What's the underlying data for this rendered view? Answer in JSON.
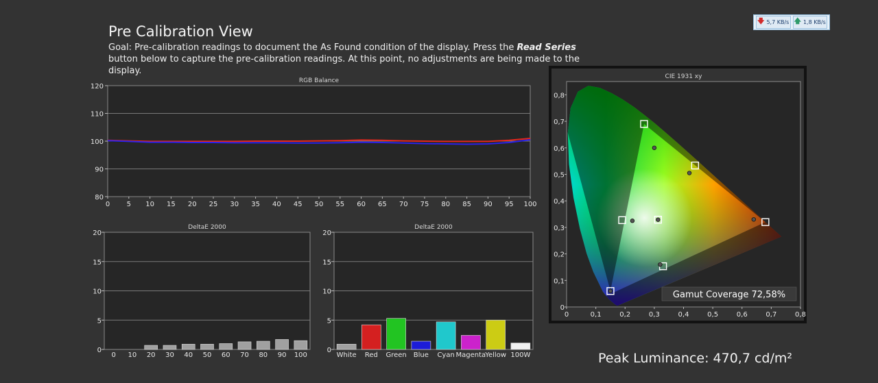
{
  "header": {
    "title": "Pre Calibration View",
    "goal_prefix": "Goal: Pre-calibration readings to document the As Found condition of the display. Press the ",
    "goal_emphasis": "Read Series",
    "goal_suffix": " button below to capture the pre-calibration readings. At this point, no adjustments are being made to the display."
  },
  "network": {
    "download": "5,7 KB/s",
    "upload": "1,8 KB/s"
  },
  "colors": {
    "red_line": "#e8261c",
    "blue_line": "#2b22e8",
    "gray_bar": "#a0a0a0",
    "red_bar": "#d42020",
    "green_bar": "#22c422",
    "blue_bar": "#1c1cd8",
    "cyan_bar": "#20c8cc",
    "magenta_bar": "#cc22cc",
    "yellow_bar": "#cccc14",
    "white_bar": "#f2f2f2"
  },
  "chart_data": [
    {
      "type": "line",
      "title": "RGB Balance",
      "x": [
        0,
        5,
        10,
        15,
        20,
        25,
        30,
        35,
        40,
        45,
        50,
        55,
        60,
        65,
        70,
        75,
        80,
        85,
        90,
        95,
        100
      ],
      "xticks": [
        "0",
        "5",
        "10",
        "15",
        "20",
        "25",
        "30",
        "35",
        "40",
        "45",
        "50",
        "55",
        "60",
        "65",
        "70",
        "75",
        "80",
        "85",
        "90",
        "95",
        "100"
      ],
      "yticks": [
        "80",
        "90",
        "100",
        "110",
        "120"
      ],
      "xlim": [
        0,
        100
      ],
      "ylim": [
        80,
        120
      ],
      "grid": true,
      "series": [
        {
          "values": [
            100.3,
            100.1,
            99.9,
            99.9,
            99.9,
            99.9,
            99.9,
            100.0,
            100.0,
            100.0,
            100.1,
            100.2,
            100.4,
            100.3,
            100.1,
            100.0,
            99.9,
            99.9,
            99.9,
            100.3,
            101.0
          ]
        },
        {
          "values": [
            100.2,
            99.9,
            99.6,
            99.6,
            99.5,
            99.5,
            99.4,
            99.4,
            99.4,
            99.3,
            99.3,
            99.4,
            99.6,
            99.5,
            99.3,
            99.1,
            99.0,
            98.9,
            99.0,
            99.5,
            100.5
          ]
        }
      ]
    },
    {
      "type": "bar",
      "title": "DeltaE 2000",
      "categories": [
        "0",
        "10",
        "20",
        "30",
        "40",
        "50",
        "60",
        "70",
        "80",
        "90",
        "100"
      ],
      "values": [
        0,
        0,
        0.7,
        0.7,
        0.9,
        0.9,
        1.0,
        1.3,
        1.4,
        1.7,
        1.5
      ],
      "yticks": [
        "0",
        "5",
        "10",
        "15",
        "20"
      ],
      "ylim": [
        0,
        20
      ],
      "grid": true
    },
    {
      "type": "bar",
      "title": "DeltaE 2000",
      "categories": [
        "White",
        "Red",
        "Green",
        "Blue",
        "Cyan",
        "Magenta",
        "Yellow",
        "100W"
      ],
      "values": [
        0.9,
        4.2,
        5.3,
        1.4,
        4.7,
        2.4,
        5.0,
        1.1
      ],
      "yticks": [
        "0",
        "5",
        "10",
        "15",
        "20"
      ],
      "ylim": [
        0,
        20
      ],
      "grid": true
    },
    {
      "type": "scatter",
      "title": "CIE 1931 xy",
      "xticks": [
        "0",
        "0,1",
        "0,2",
        "0,3",
        "0,4",
        "0,5",
        "0,6",
        "0,7",
        "0,8"
      ],
      "yticks": [
        "0",
        "0,1",
        "0,2",
        "0,3",
        "0,4",
        "0,5",
        "0,6",
        "0,7",
        "0,8"
      ],
      "xlim": [
        0,
        0.8
      ],
      "ylim": [
        0,
        0.85
      ],
      "target_gamut": [
        [
          0.68,
          0.32
        ],
        [
          0.265,
          0.69
        ],
        [
          0.15,
          0.06
        ]
      ],
      "targets": [
        [
          0.68,
          0.32
        ],
        [
          0.265,
          0.69
        ],
        [
          0.15,
          0.06
        ],
        [
          0.4395,
          0.5333
        ],
        [
          0.1901,
          0.3273
        ],
        [
          0.3299,
          0.1535
        ],
        [
          0.3127,
          0.329
        ]
      ],
      "measured": [
        [
          0.64,
          0.33
        ],
        [
          0.3,
          0.6
        ],
        [
          0.15,
          0.06
        ],
        [
          0.42,
          0.505
        ],
        [
          0.225,
          0.325
        ],
        [
          0.32,
          0.16
        ],
        [
          0.3127,
          0.329
        ]
      ],
      "annotation": "Gamut Coverage 72,58%"
    }
  ],
  "footer": {
    "peak_luminance": "Peak Luminance: 470,7 cd/m²"
  }
}
